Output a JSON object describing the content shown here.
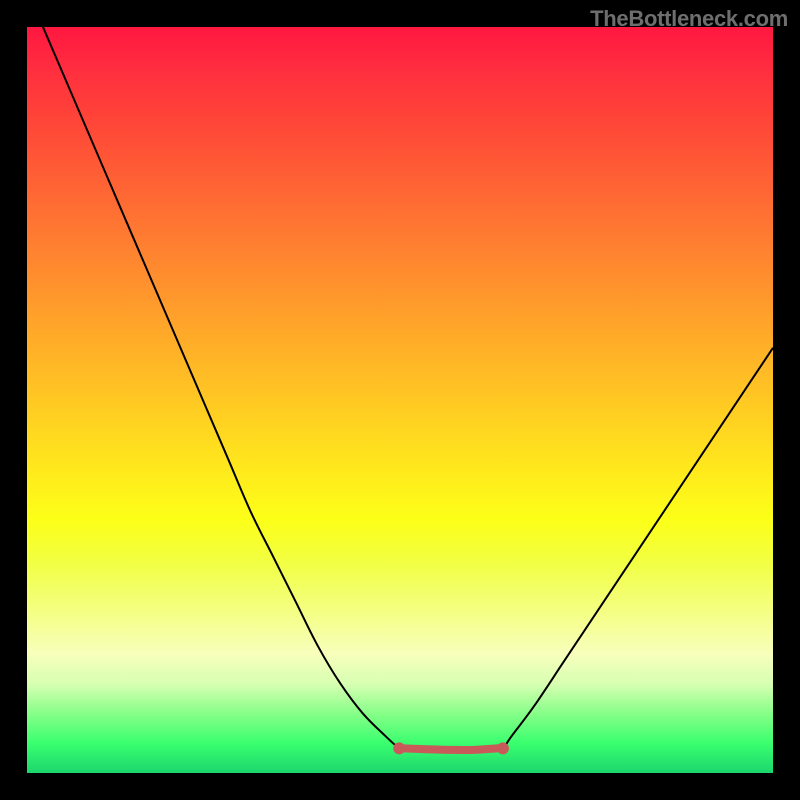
{
  "watermark": "TheBottleneck.com",
  "chart_data": {
    "type": "line",
    "title": "",
    "xlabel": "",
    "ylabel": "",
    "xlim": [
      0,
      100
    ],
    "ylim": [
      0,
      100
    ],
    "grid": false,
    "series": [
      {
        "name": "bottleneck-curve",
        "color": "#000000",
        "x": [
          0,
          3,
          6,
          9,
          12,
          15,
          18,
          21,
          24,
          27,
          30,
          33,
          36,
          39,
          42,
          45,
          48,
          49.9,
          50.5,
          53,
          57,
          60,
          63,
          63.8,
          65,
          68,
          72,
          76,
          80,
          84,
          88,
          92,
          96,
          100
        ],
        "y": [
          -5,
          2,
          9,
          16,
          23,
          30,
          37,
          44,
          51,
          58,
          65,
          71,
          77,
          83,
          88,
          92,
          95,
          96.7,
          96.7,
          96.8,
          96.9,
          96.9,
          96.7,
          96.7,
          95,
          91,
          85,
          79,
          73,
          67,
          61,
          55,
          49,
          43
        ]
      },
      {
        "name": "flat-bottom-highlight",
        "color": "#c85a5a",
        "thick": true,
        "x": [
          49.9,
          50.5,
          53,
          57,
          60,
          63,
          63.8
        ],
        "y": [
          96.7,
          96.7,
          96.8,
          96.9,
          96.9,
          96.7,
          96.7
        ]
      }
    ],
    "flat_bottom_endpoints": {
      "left": {
        "x": 49.9,
        "y": 96.7,
        "marker": true
      },
      "right": {
        "x": 63.8,
        "y": 96.7,
        "marker": true
      }
    },
    "background_gradient": {
      "type": "vertical",
      "stops": [
        {
          "pos": 0.0,
          "color": "#ff1740"
        },
        {
          "pos": 0.5,
          "color": "#ffc124"
        },
        {
          "pos": 0.8,
          "color": "#f4ff80"
        },
        {
          "pos": 1.0,
          "color": "#1bd66d"
        }
      ]
    }
  }
}
